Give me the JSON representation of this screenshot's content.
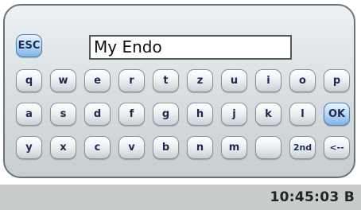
{
  "input": {
    "value": "My Endo"
  },
  "keys": {
    "esc": "ESC",
    "row1": [
      "q",
      "w",
      "e",
      "r",
      "t",
      "z",
      "u",
      "i",
      "o",
      "p"
    ],
    "row2": [
      "a",
      "s",
      "d",
      "f",
      "g",
      "h",
      "j",
      "k",
      "l",
      "OK"
    ],
    "row3": [
      "y",
      "x",
      "c",
      "v",
      "b",
      "n",
      "m",
      "",
      "2nd",
      "<--"
    ]
  },
  "status": {
    "time": "10:45:03 B"
  },
  "colors": {
    "accent_key": "#9cc6ee",
    "panel_border": "#6b7377",
    "status_bar": "#c9cccd"
  }
}
